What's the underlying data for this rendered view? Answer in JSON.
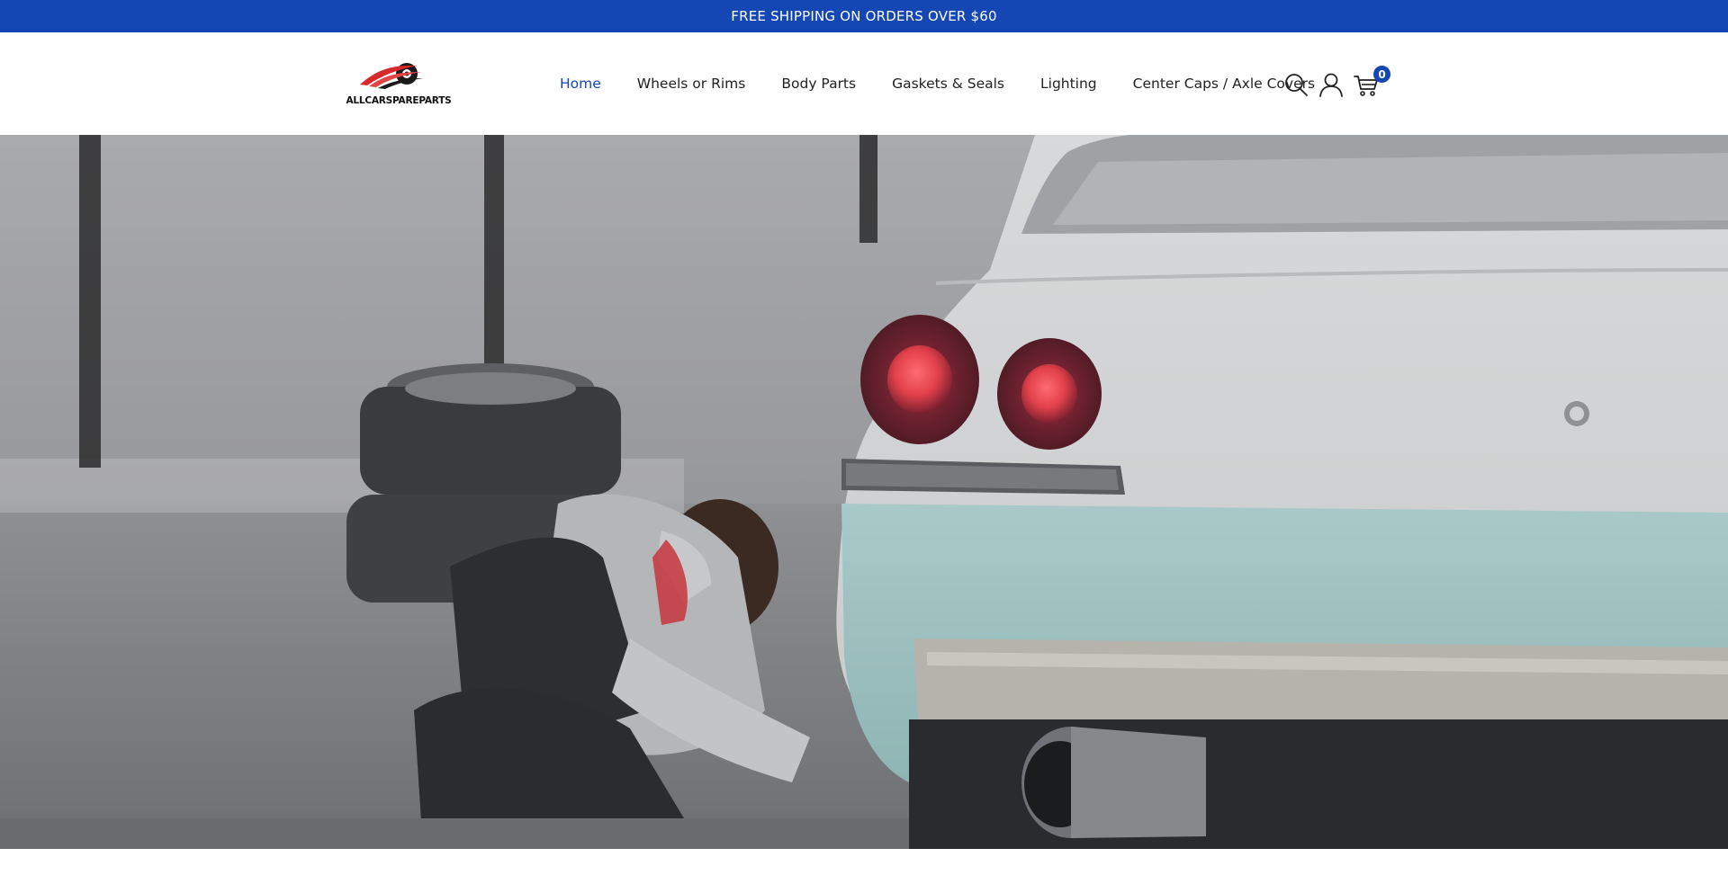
{
  "theme": {
    "accent": "#1446b4"
  },
  "announcement": {
    "text": "FREE SHIPPING ON ORDERS OVER $60"
  },
  "logo": {
    "text": "ALLCARSPAREPARTS"
  },
  "nav": {
    "items": [
      {
        "label": "Home",
        "active": true
      },
      {
        "label": "Wheels or Rims"
      },
      {
        "label": "Body Parts"
      },
      {
        "label": "Gaskets & Seals"
      },
      {
        "label": "Lighting"
      },
      {
        "label": "Center Caps / Axle Covers"
      }
    ]
  },
  "header_icons": {
    "search": "search-icon",
    "account": "user-icon",
    "cart": "cart-icon",
    "cart_count": "0"
  }
}
